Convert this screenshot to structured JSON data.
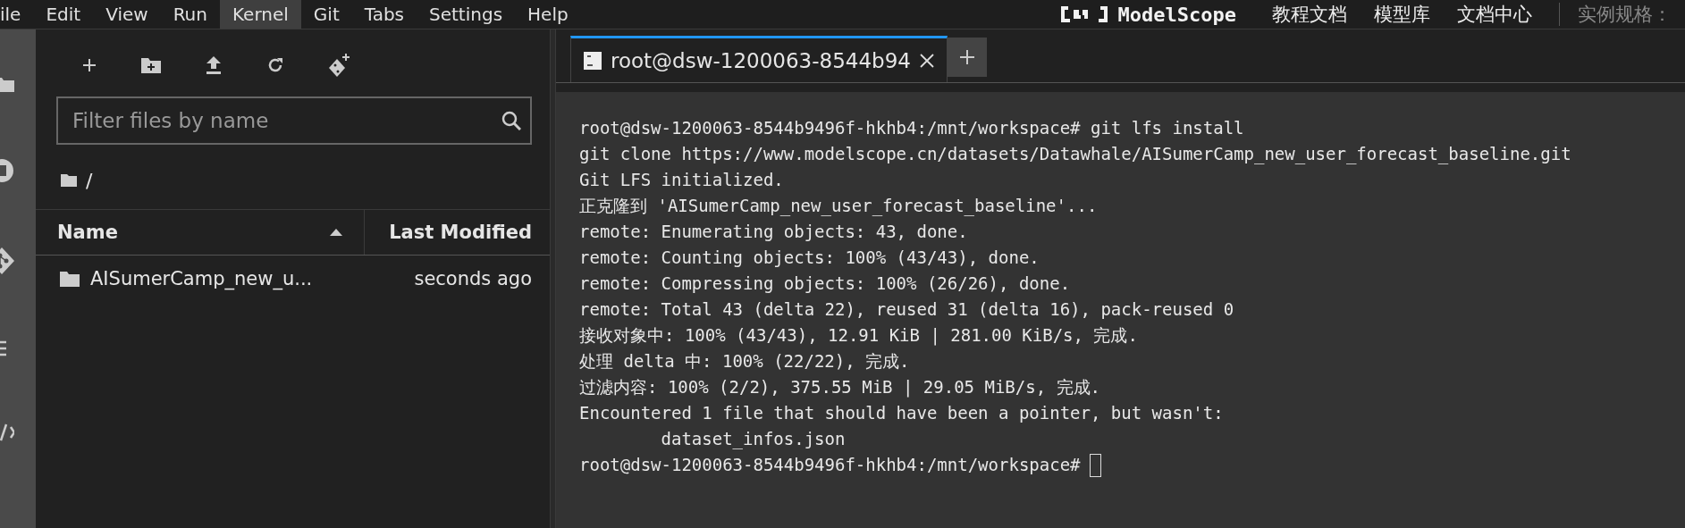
{
  "menu": [
    {
      "label": "ile",
      "selected": false
    },
    {
      "label": "Edit",
      "selected": false
    },
    {
      "label": "View",
      "selected": false
    },
    {
      "label": "Run",
      "selected": false
    },
    {
      "label": "Kernel",
      "selected": true
    },
    {
      "label": "Git",
      "selected": false
    },
    {
      "label": "Tabs",
      "selected": false
    },
    {
      "label": "Settings",
      "selected": false
    },
    {
      "label": "Help",
      "selected": false
    }
  ],
  "header": {
    "logo": "ModelScope",
    "links": [
      "教程文档",
      "模型库",
      "文档中心"
    ],
    "instance": "实例规格："
  },
  "file_browser": {
    "search": {
      "placeholder": "Filter files by name"
    },
    "breadcrumb": "/",
    "columns": [
      {
        "label": "Name",
        "sorted": true
      },
      {
        "label": "Last Modified",
        "sorted": false
      }
    ],
    "rows": [
      {
        "name": "AISumerCamp_new_u...",
        "modified": "seconds ago",
        "selected": false
      }
    ]
  },
  "terminal": {
    "tabs": [
      {
        "title": "root@dsw-1200063-8544b94",
        "selected": true
      }
    ],
    "lines": [
      "root@dsw-1200063-8544b9496f-hkhb4:/mnt/workspace# git lfs install",
      "git clone https://www.modelscope.cn/datasets/Datawhale/AISumerCamp_new_user_forecast_baseline.git",
      "Git LFS initialized.",
      "正克隆到 'AISumerCamp_new_user_forecast_baseline'...",
      "remote: Enumerating objects: 43, done.",
      "remote: Counting objects: 100% (43/43), done.",
      "remote: Compressing objects: 100% (26/26), done.",
      "remote: Total 43 (delta 22), reused 31 (delta 16), pack-reused 0",
      "接收对象中: 100% (43/43), 12.91 KiB | 281.00 KiB/s, 完成.",
      "处理 delta 中: 100% (22/22), 完成.",
      "过滤内容: 100% (2/2), 375.55 MiB | 29.05 MiB/s, 完成.",
      "Encountered 1 file that should have been a pointer, but wasn't:",
      "        dataset_infos.json"
    ],
    "prompt": "root@dsw-1200063-8544b9496f-hkhb4:/mnt/workspace#"
  }
}
